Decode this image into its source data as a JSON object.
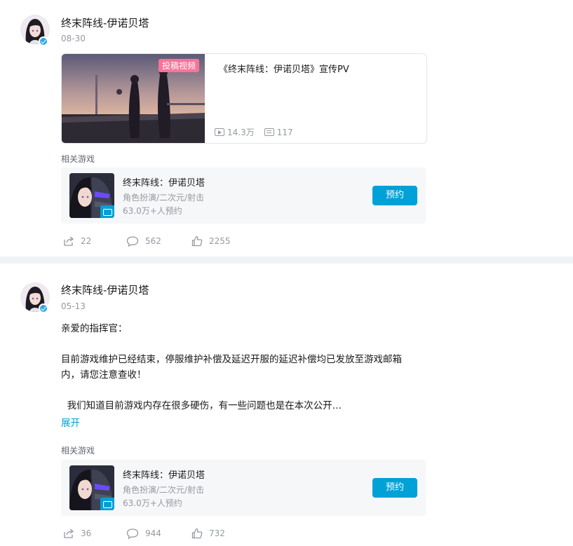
{
  "posts": [
    {
      "author": "终末阵线-伊诺贝塔",
      "date": "08-30",
      "video": {
        "badge": "投稿视频",
        "title": "《终末阵线：伊诺贝塔》宣传PV",
        "plays": "14.3万",
        "danmaku": "117"
      },
      "related_label": "相关游戏",
      "game": {
        "name": "终末阵线：伊诺贝塔",
        "tags": "角色扮演/二次元/射击",
        "count": "63.0万+人预约",
        "button": "预约"
      },
      "stats": {
        "share": "22",
        "comment": "562",
        "like": "2255"
      }
    },
    {
      "author": "终末阵线-伊诺贝塔",
      "date": "05-13",
      "paragraphs": [
        "亲爱的指挥官：",
        "目前游戏维护已经结束，停服维护补偿及延迟开服的延迟补偿均已发放至游戏邮箱",
        "内，请您注意查收！",
        "  我们知道目前游戏内存在很多硬伤，有一些问题也是在本次公开…"
      ],
      "expand": "展开",
      "related_label": "相关游戏",
      "game": {
        "name": "终末阵线：伊诺贝塔",
        "tags": "角色扮演/二次元/射击",
        "count": "63.0万+人预约",
        "button": "预约"
      },
      "stats": {
        "share": "36",
        "comment": "944",
        "like": "732"
      }
    }
  ],
  "icons": {
    "share": "share-icon",
    "comment": "comment-icon",
    "like": "like-icon",
    "play": "play-icon",
    "danmaku": "danmaku-icon",
    "verified": "verified-icon"
  },
  "colors": {
    "accent": "#00a1d6",
    "badge": "#fb7299",
    "muted": "#9499a0",
    "card_bg": "#f6f7f8"
  }
}
